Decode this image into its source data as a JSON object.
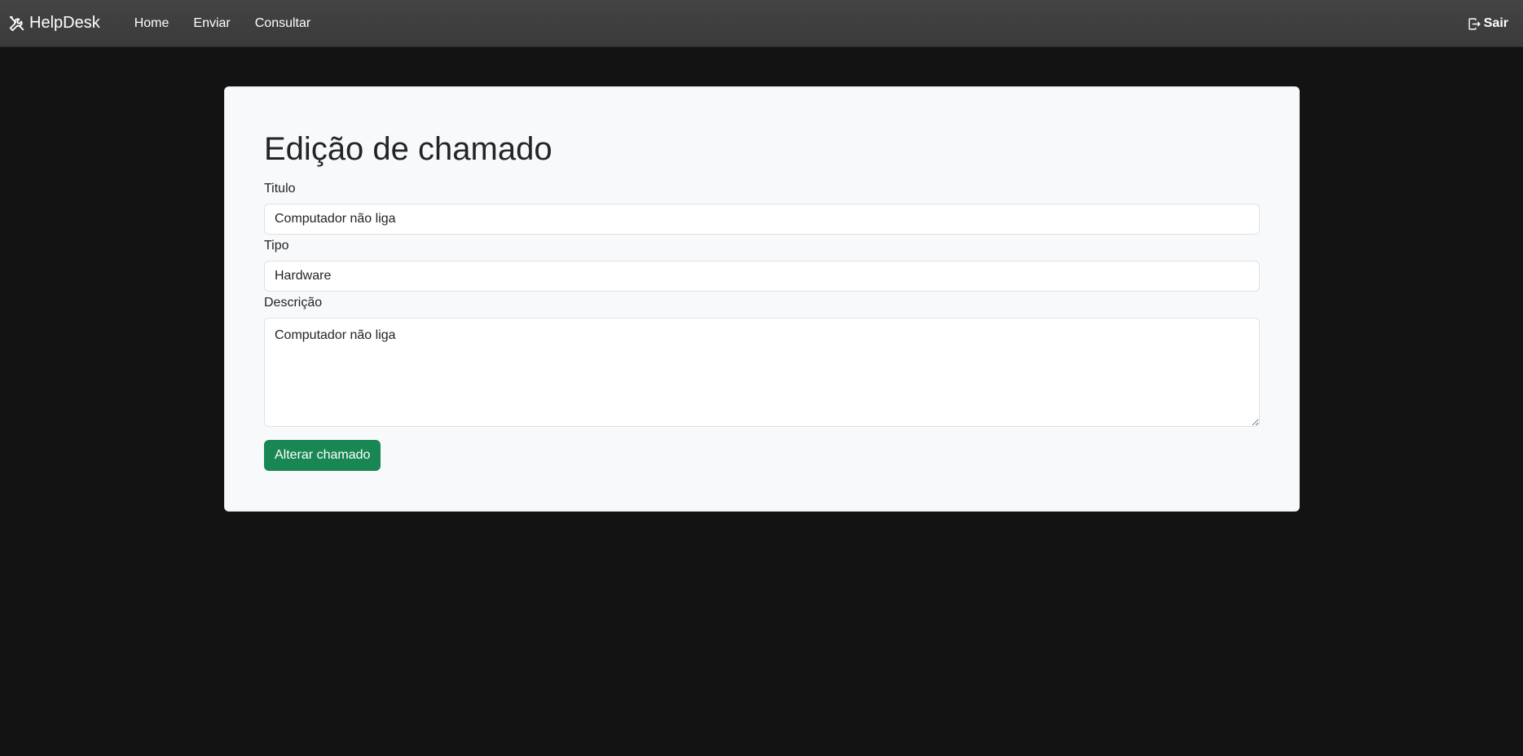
{
  "navbar": {
    "brand": "HelpDesk",
    "brand_icon": "tools-icon",
    "links": [
      {
        "label": "Home"
      },
      {
        "label": "Enviar"
      },
      {
        "label": "Consultar"
      }
    ],
    "logout_label": "Sair",
    "logout_icon": "logout-icon"
  },
  "form": {
    "title": "Edição de chamado",
    "titulo_label": "Titulo",
    "titulo_value": "Computador não liga",
    "tipo_label": "Tipo",
    "tipo_value": "Hardware",
    "descricao_label": "Descrição",
    "descricao_value": "Computador não liga",
    "submit_label": "Alterar chamado"
  },
  "colors": {
    "background": "#131313",
    "navbar": "#3f3f3f",
    "card": "#f8f9fa",
    "button": "#198754"
  }
}
